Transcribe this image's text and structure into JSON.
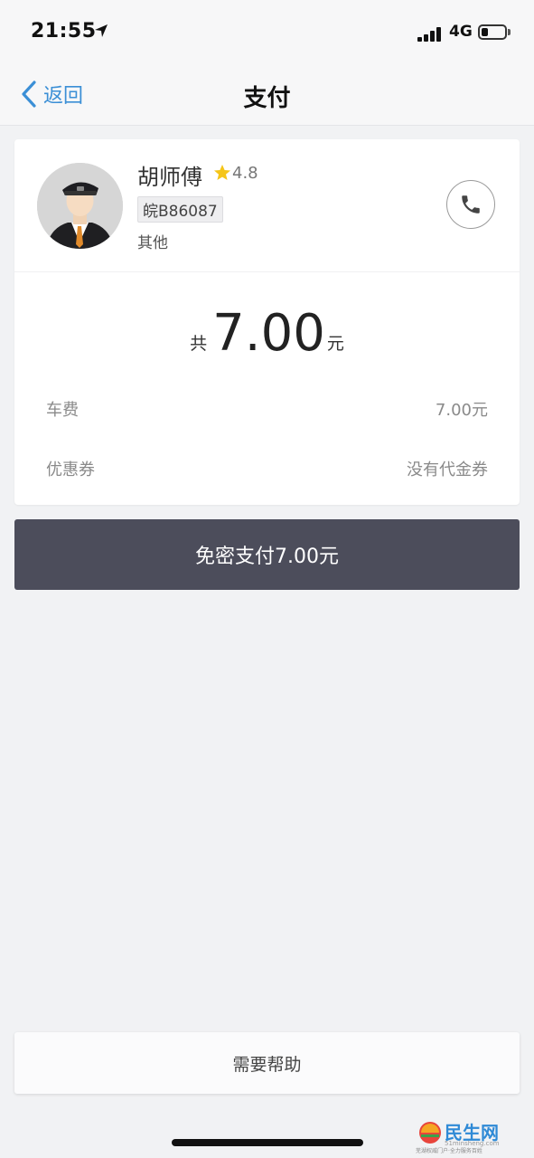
{
  "status_bar": {
    "time": "21:55",
    "network": "4G",
    "battery_level": 0.3,
    "signal_bars": 4
  },
  "nav": {
    "back_label": "返回",
    "title": "支付"
  },
  "driver": {
    "name": "胡师傅",
    "rating": "4.8",
    "plate": "皖B86087",
    "car_type": "其他"
  },
  "fare": {
    "total_prefix": "共",
    "total_amount": "7.00",
    "total_unit": "元",
    "lines": [
      {
        "label": "车费",
        "value": "7.00元"
      },
      {
        "label": "优惠券",
        "value": "没有代金券"
      }
    ]
  },
  "actions": {
    "pay_label": "免密支付7.00元",
    "help_label": "需要帮助"
  },
  "watermark": {
    "brand": "民生网",
    "domain": "51minsheng.com",
    "tagline": "芜湖权威门户·全力服务百姓"
  },
  "colors": {
    "accent_blue": "#3b8fd6",
    "pay_button": "#4c4d5b",
    "background": "#f1f2f4",
    "star": "#f5c518"
  }
}
